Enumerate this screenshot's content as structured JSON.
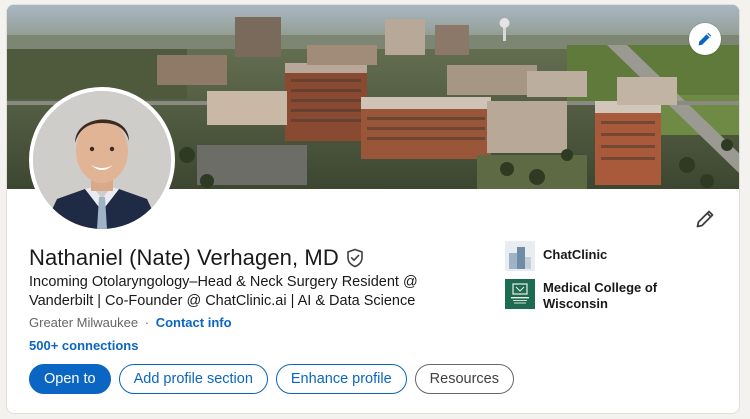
{
  "profile": {
    "name": "Nathaniel (Nate) Verhagen, MD",
    "headline": "Incoming Otolaryngology–Head & Neck Surgery Resident @ Vanderbilt | Co-Founder @ ChatClinic.ai | AI & Data Science",
    "location": "Greater Milwaukee",
    "separator": "·",
    "contact_link": "Contact info",
    "connections": "500+ connections"
  },
  "buttons": {
    "open_to": "Open to",
    "add_section": "Add profile section",
    "enhance": "Enhance profile",
    "resources": "Resources"
  },
  "organizations": [
    {
      "name": "ChatClinic",
      "logo": "chatclinic-logo"
    },
    {
      "name": "Medical College of Wisconsin",
      "logo": "mcw-logo"
    }
  ],
  "icons": {
    "banner_edit": "pencil-icon",
    "profile_edit": "pencil-icon",
    "verified": "verified-shield-icon"
  },
  "colors": {
    "accent": "#0a66c2",
    "text_primary": "#191919",
    "text_secondary": "#666666",
    "mcw_green": "#1f6b52"
  }
}
